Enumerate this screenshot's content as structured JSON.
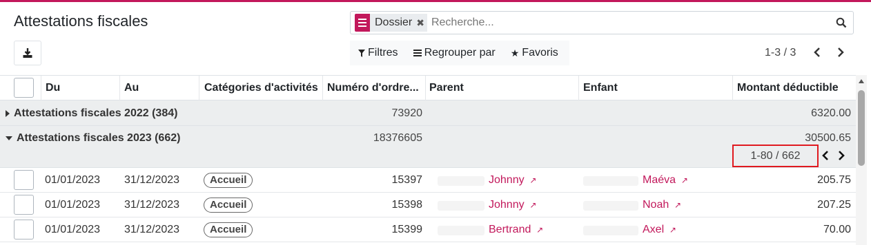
{
  "page": {
    "title": "Attestations fiscales",
    "accent_color": "#c2185b",
    "highlight_color": "#e0191f"
  },
  "search": {
    "facet_label": "Dossier",
    "placeholder": "Recherche..."
  },
  "toolbar": {
    "filters_label": "Filtres",
    "groupby_label": "Regrouper par",
    "favorites_label": "Favoris",
    "pager": "1-3 / 3"
  },
  "columns": [
    "Du",
    "Au",
    "Catégories d'activités",
    "Numéro d'ordre...",
    "Parent",
    "Enfant",
    "Montant déductible"
  ],
  "groups": [
    {
      "label": "Attestations fiscales 2022 (384)",
      "expanded": false,
      "order_total": "73920",
      "amount_total": "6320.00"
    },
    {
      "label": "Attestations fiscales 2023 (662)",
      "expanded": true,
      "order_total": "18376605",
      "amount_total": "30500.65",
      "pager": "1-80 / 662"
    }
  ],
  "rows": [
    {
      "du": "01/01/2023",
      "au": "31/12/2023",
      "category": "Accueil",
      "order": "15397",
      "parent": "Johnny",
      "child": "Maéva",
      "amount": "205.75"
    },
    {
      "du": "01/01/2023",
      "au": "31/12/2023",
      "category": "Accueil",
      "order": "15398",
      "parent": "Johnny",
      "child": "Noah",
      "amount": "207.25"
    },
    {
      "du": "01/01/2023",
      "au": "31/12/2023",
      "category": "Accueil",
      "order": "15399",
      "parent": "Bertrand",
      "child": "Axel",
      "amount": "70.00"
    }
  ]
}
